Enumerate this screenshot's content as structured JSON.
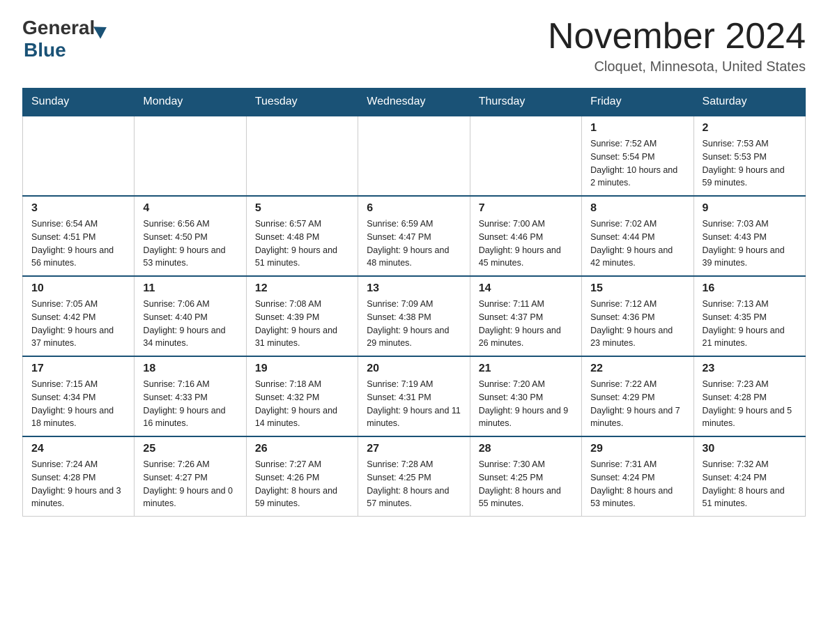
{
  "header": {
    "title": "November 2024",
    "subtitle": "Cloquet, Minnesota, United States"
  },
  "logo": {
    "general": "General",
    "blue": "Blue"
  },
  "days_of_week": [
    "Sunday",
    "Monday",
    "Tuesday",
    "Wednesday",
    "Thursday",
    "Friday",
    "Saturday"
  ],
  "weeks": [
    {
      "days": [
        {
          "number": "",
          "info": ""
        },
        {
          "number": "",
          "info": ""
        },
        {
          "number": "",
          "info": ""
        },
        {
          "number": "",
          "info": ""
        },
        {
          "number": "",
          "info": ""
        },
        {
          "number": "1",
          "info": "Sunrise: 7:52 AM\nSunset: 5:54 PM\nDaylight: 10 hours and 2 minutes."
        },
        {
          "number": "2",
          "info": "Sunrise: 7:53 AM\nSunset: 5:53 PM\nDaylight: 9 hours and 59 minutes."
        }
      ]
    },
    {
      "days": [
        {
          "number": "3",
          "info": "Sunrise: 6:54 AM\nSunset: 4:51 PM\nDaylight: 9 hours and 56 minutes."
        },
        {
          "number": "4",
          "info": "Sunrise: 6:56 AM\nSunset: 4:50 PM\nDaylight: 9 hours and 53 minutes."
        },
        {
          "number": "5",
          "info": "Sunrise: 6:57 AM\nSunset: 4:48 PM\nDaylight: 9 hours and 51 minutes."
        },
        {
          "number": "6",
          "info": "Sunrise: 6:59 AM\nSunset: 4:47 PM\nDaylight: 9 hours and 48 minutes."
        },
        {
          "number": "7",
          "info": "Sunrise: 7:00 AM\nSunset: 4:46 PM\nDaylight: 9 hours and 45 minutes."
        },
        {
          "number": "8",
          "info": "Sunrise: 7:02 AM\nSunset: 4:44 PM\nDaylight: 9 hours and 42 minutes."
        },
        {
          "number": "9",
          "info": "Sunrise: 7:03 AM\nSunset: 4:43 PM\nDaylight: 9 hours and 39 minutes."
        }
      ]
    },
    {
      "days": [
        {
          "number": "10",
          "info": "Sunrise: 7:05 AM\nSunset: 4:42 PM\nDaylight: 9 hours and 37 minutes."
        },
        {
          "number": "11",
          "info": "Sunrise: 7:06 AM\nSunset: 4:40 PM\nDaylight: 9 hours and 34 minutes."
        },
        {
          "number": "12",
          "info": "Sunrise: 7:08 AM\nSunset: 4:39 PM\nDaylight: 9 hours and 31 minutes."
        },
        {
          "number": "13",
          "info": "Sunrise: 7:09 AM\nSunset: 4:38 PM\nDaylight: 9 hours and 29 minutes."
        },
        {
          "number": "14",
          "info": "Sunrise: 7:11 AM\nSunset: 4:37 PM\nDaylight: 9 hours and 26 minutes."
        },
        {
          "number": "15",
          "info": "Sunrise: 7:12 AM\nSunset: 4:36 PM\nDaylight: 9 hours and 23 minutes."
        },
        {
          "number": "16",
          "info": "Sunrise: 7:13 AM\nSunset: 4:35 PM\nDaylight: 9 hours and 21 minutes."
        }
      ]
    },
    {
      "days": [
        {
          "number": "17",
          "info": "Sunrise: 7:15 AM\nSunset: 4:34 PM\nDaylight: 9 hours and 18 minutes."
        },
        {
          "number": "18",
          "info": "Sunrise: 7:16 AM\nSunset: 4:33 PM\nDaylight: 9 hours and 16 minutes."
        },
        {
          "number": "19",
          "info": "Sunrise: 7:18 AM\nSunset: 4:32 PM\nDaylight: 9 hours and 14 minutes."
        },
        {
          "number": "20",
          "info": "Sunrise: 7:19 AM\nSunset: 4:31 PM\nDaylight: 9 hours and 11 minutes."
        },
        {
          "number": "21",
          "info": "Sunrise: 7:20 AM\nSunset: 4:30 PM\nDaylight: 9 hours and 9 minutes."
        },
        {
          "number": "22",
          "info": "Sunrise: 7:22 AM\nSunset: 4:29 PM\nDaylight: 9 hours and 7 minutes."
        },
        {
          "number": "23",
          "info": "Sunrise: 7:23 AM\nSunset: 4:28 PM\nDaylight: 9 hours and 5 minutes."
        }
      ]
    },
    {
      "days": [
        {
          "number": "24",
          "info": "Sunrise: 7:24 AM\nSunset: 4:28 PM\nDaylight: 9 hours and 3 minutes."
        },
        {
          "number": "25",
          "info": "Sunrise: 7:26 AM\nSunset: 4:27 PM\nDaylight: 9 hours and 0 minutes."
        },
        {
          "number": "26",
          "info": "Sunrise: 7:27 AM\nSunset: 4:26 PM\nDaylight: 8 hours and 59 minutes."
        },
        {
          "number": "27",
          "info": "Sunrise: 7:28 AM\nSunset: 4:25 PM\nDaylight: 8 hours and 57 minutes."
        },
        {
          "number": "28",
          "info": "Sunrise: 7:30 AM\nSunset: 4:25 PM\nDaylight: 8 hours and 55 minutes."
        },
        {
          "number": "29",
          "info": "Sunrise: 7:31 AM\nSunset: 4:24 PM\nDaylight: 8 hours and 53 minutes."
        },
        {
          "number": "30",
          "info": "Sunrise: 7:32 AM\nSunset: 4:24 PM\nDaylight: 8 hours and 51 minutes."
        }
      ]
    }
  ]
}
